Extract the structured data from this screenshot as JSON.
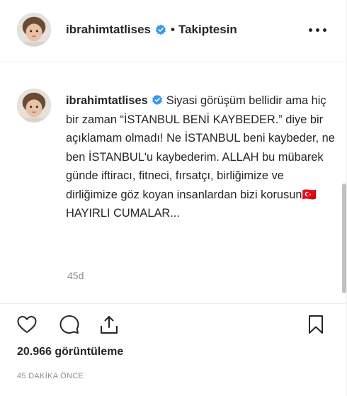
{
  "header": {
    "username": "ibrahimtatlises",
    "verified_icon": "verified-badge-icon",
    "separator": "•",
    "follow_status": "Takiptesin",
    "more_icon": "more-options-icon"
  },
  "comment": {
    "username": "ibrahimtatlises",
    "caption": "Siyasi görüşüm bellidir ama hiç bir zaman “İSTANBUL BENİ KAYBEDER.” diye bir açıklamam olmadı! Ne İSTANBUL beni kaybeder, ne ben İSTANBUL'u kaybederim. ALLAH bu mübarek günde iftiracı, fitneci, fırsatçı, birliğimize ve dirliğimize göz koyan insanlardan bizi korusun🇹🇷HAYIRLI CUMALAR...",
    "time": "45d"
  },
  "actions": {
    "icons": [
      "heart-icon",
      "comment-icon",
      "share-icon",
      "bookmark-icon"
    ],
    "views": "20.966 görüntüleme",
    "posted": "45 DAKİKA ÖNCE"
  },
  "colors": {
    "text": "#262626",
    "muted": "#8e8e8e",
    "verified": "#3897f0",
    "border": "#efefef"
  }
}
